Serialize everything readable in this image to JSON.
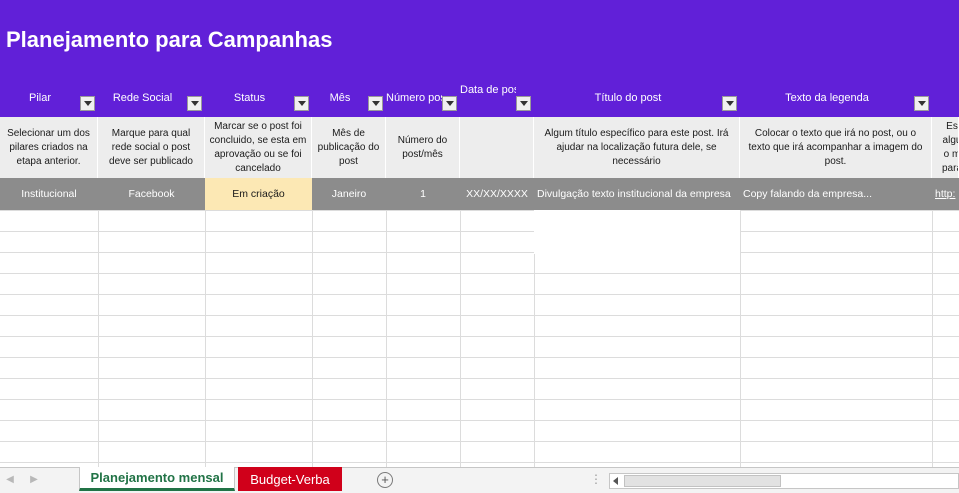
{
  "title": "Planejamento para Campanhas",
  "columns": [
    {
      "header": "Pilar",
      "description": "Selecionar um dos pilares criados na etapa anterior.",
      "example": "Institucional"
    },
    {
      "header": "Rede Social",
      "description": "Marque para qual rede social o post deve ser publicado",
      "example": "Facebook"
    },
    {
      "header": "Status",
      "description": "Marcar se o post foi concluido, se esta em aprovação ou se foi cancelado",
      "example": "Em criação"
    },
    {
      "header": "Mês",
      "description": "Mês de publicação do post",
      "example": "Janeiro"
    },
    {
      "header": "Número post",
      "description": "Número do post/mês",
      "example": "1"
    },
    {
      "header": "Data de postagem",
      "description": "",
      "example": "XX/XX/XXXX"
    },
    {
      "header": "Título do post",
      "description": "Algum título específico para este post. Irá ajudar na localização futura dele, se necessário",
      "example": "Divulgação texto  institucional da empresa"
    },
    {
      "header": "Texto da legenda",
      "description": "Colocar o texto que irá no post, ou o texto que irá acompanhar a imagem do post.",
      "example": "Copy falando da empresa..."
    },
    {
      "header": "",
      "description": "Es algu o m para",
      "example": "http:"
    }
  ],
  "sheet_tabs": [
    {
      "label": "Planejamento mensal",
      "active": true
    },
    {
      "label": "Budget-Verba",
      "active": false
    }
  ],
  "add_sheet_symbol": "+",
  "colors": {
    "header_bg": "#6120d8",
    "description_bg": "#ededed",
    "example_bg": "#8c8c8c",
    "status_bg": "#fce8b4",
    "active_tab": "#217346",
    "red_tab": "#d0001a"
  }
}
